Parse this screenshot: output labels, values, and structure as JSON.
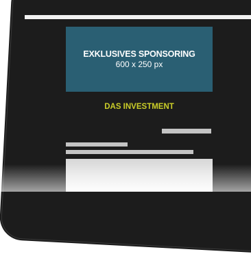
{
  "ad": {
    "title": "EXKLUSIVES SPONSORING",
    "size": "600 x 250 px",
    "background": "#2a5f73"
  },
  "section": {
    "label": "DAS INVESTMENT",
    "color": "#c7ca2a"
  }
}
